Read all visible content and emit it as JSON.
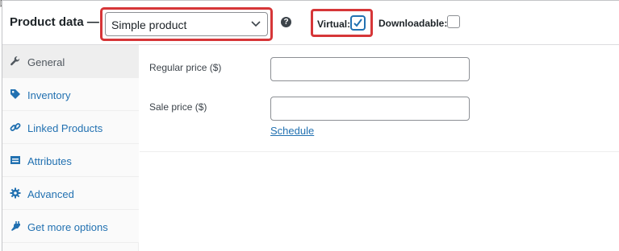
{
  "header": {
    "title": "Product data —",
    "product_type": {
      "selected": "Simple product"
    },
    "help_icon": "question-circle-icon",
    "virtual": {
      "label": "Virtual:",
      "checked": true
    },
    "downloadable": {
      "label": "Downloadable:",
      "checked": false
    }
  },
  "sidebar": {
    "tabs": [
      {
        "label": "General",
        "icon": "wrench-icon",
        "active": true
      },
      {
        "label": "Inventory",
        "icon": "tag-icon",
        "active": false
      },
      {
        "label": "Linked Products",
        "icon": "link-icon",
        "active": false
      },
      {
        "label": "Attributes",
        "icon": "table-icon",
        "active": false
      },
      {
        "label": "Advanced",
        "icon": "gear-icon",
        "active": false
      },
      {
        "label": "Get more options",
        "icon": "plugin-icon",
        "active": false
      }
    ]
  },
  "general": {
    "regular_price": {
      "label": "Regular price ($)",
      "value": ""
    },
    "sale_price": {
      "label": "Sale price ($)",
      "value": ""
    },
    "schedule_link": "Schedule"
  },
  "colors": {
    "highlight": "#d63638",
    "link": "#2271b1",
    "active_tab_bg": "#eeeeee"
  }
}
